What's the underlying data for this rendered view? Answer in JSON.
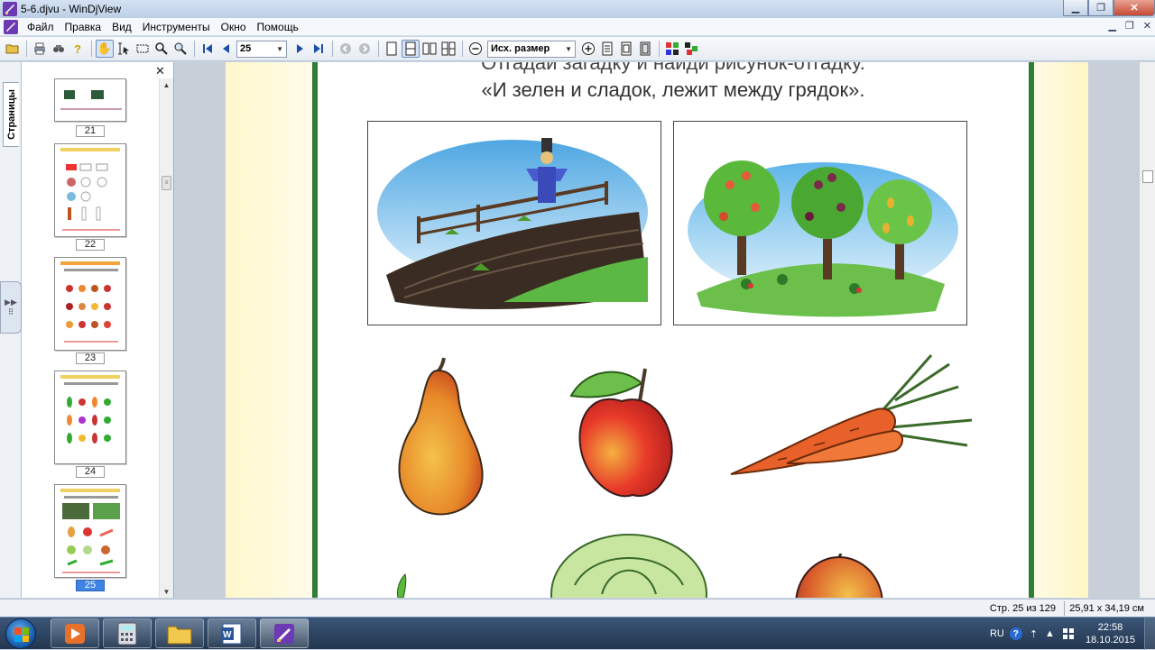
{
  "window": {
    "title": "5-6.djvu - WinDjView"
  },
  "menu": [
    "Файл",
    "Правка",
    "Вид",
    "Инструменты",
    "Окно",
    "Помощь"
  ],
  "toolbar": {
    "page_value": "25",
    "zoom_value": "Исх. размер"
  },
  "sidebar": {
    "tab_label": "Страницы",
    "pages": [
      {
        "num": "21",
        "active": false
      },
      {
        "num": "22",
        "active": false
      },
      {
        "num": "23",
        "active": false
      },
      {
        "num": "24",
        "active": false
      },
      {
        "num": "25",
        "active": true
      }
    ]
  },
  "document": {
    "riddle_line1": "Отгадай загадку и найди рисунок-отгадку.",
    "riddle_line2": "«И зелен и сладок, лежит между грядок».",
    "pictures": [
      "scarecrow-garden",
      "fruit-orchard",
      "pear",
      "apple",
      "carrot",
      "cabbage",
      "peach"
    ]
  },
  "status": {
    "page_info": "Стр. 25 из 129",
    "page_size": "25,91 x 34,19 см"
  },
  "taskbar": {
    "lang": "RU",
    "time": "22:58",
    "date": "18.10.2015"
  },
  "colors": {
    "accent": "#3f84e3",
    "page_border": "#2f7d36",
    "margin_yellow": "#fff5c6"
  }
}
